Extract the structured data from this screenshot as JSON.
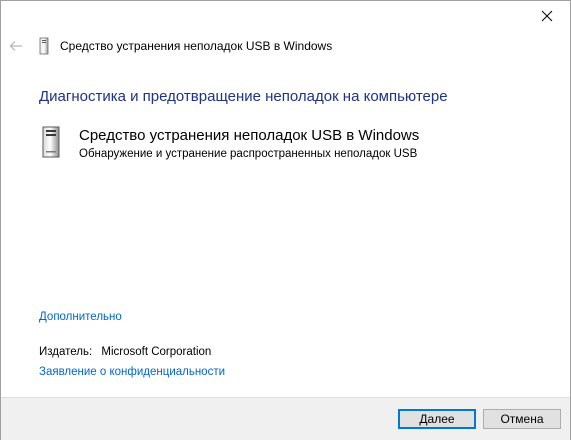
{
  "window": {
    "close_icon": "close-icon"
  },
  "header": {
    "back_icon": "back-arrow-icon",
    "title_icon": "usb-device-icon",
    "title": "Средство устранения неполадок USB в Windows"
  },
  "main": {
    "heading": "Диагностика и предотвращение неполадок на компьютере",
    "tool": {
      "icon": "usb-device-icon",
      "name": "Средство устранения неполадок USB в Windows",
      "description": "Обнаружение и устранение распространенных неполадок USB"
    },
    "advanced_link": "Дополнительно",
    "publisher": {
      "label": "Издатель:",
      "value": "Microsoft Corporation"
    },
    "privacy_link": "Заявление о конфиденциальности"
  },
  "footer": {
    "next_label": "Далее",
    "cancel_label": "Отмена"
  },
  "colors": {
    "heading": "#1e3287",
    "link": "#0066cc",
    "accent_button_border": "#0078d7",
    "footer_bg": "#f0f0f0"
  }
}
